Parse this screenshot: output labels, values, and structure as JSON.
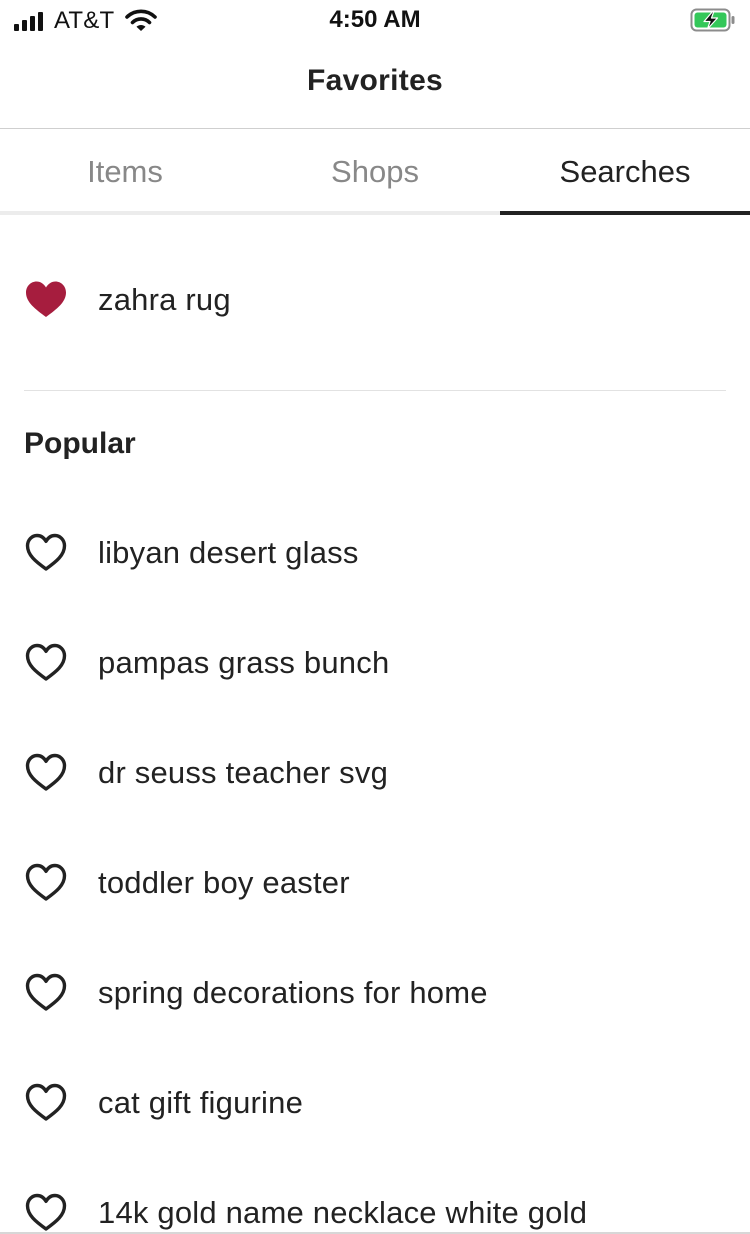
{
  "status_bar": {
    "carrier": "AT&T",
    "time": "4:50 AM",
    "battery_color": "#34c759"
  },
  "header": {
    "title": "Favorites"
  },
  "tabs": [
    {
      "label": "Items",
      "active": false
    },
    {
      "label": "Shops",
      "active": false
    },
    {
      "label": "Searches",
      "active": true
    }
  ],
  "saved_searches": [
    {
      "label": "zahra rug",
      "favorited": true,
      "icon": "heart-filled-icon"
    }
  ],
  "popular": {
    "title": "Popular",
    "items": [
      {
        "label": "libyan desert glass",
        "favorited": false,
        "icon": "heart-outline-icon"
      },
      {
        "label": "pampas grass bunch",
        "favorited": false,
        "icon": "heart-outline-icon"
      },
      {
        "label": "dr seuss teacher svg",
        "favorited": false,
        "icon": "heart-outline-icon"
      },
      {
        "label": "toddler boy easter",
        "favorited": false,
        "icon": "heart-outline-icon"
      },
      {
        "label": "spring decorations for home",
        "favorited": false,
        "icon": "heart-outline-icon"
      },
      {
        "label": "cat gift figurine",
        "favorited": false,
        "icon": "heart-outline-icon"
      },
      {
        "label": "14k gold name necklace white gold",
        "favorited": false,
        "icon": "heart-outline-icon"
      }
    ]
  },
  "colors": {
    "heart_filled": "#a61d3e",
    "text_primary": "#222222",
    "tab_inactive": "#888888"
  }
}
